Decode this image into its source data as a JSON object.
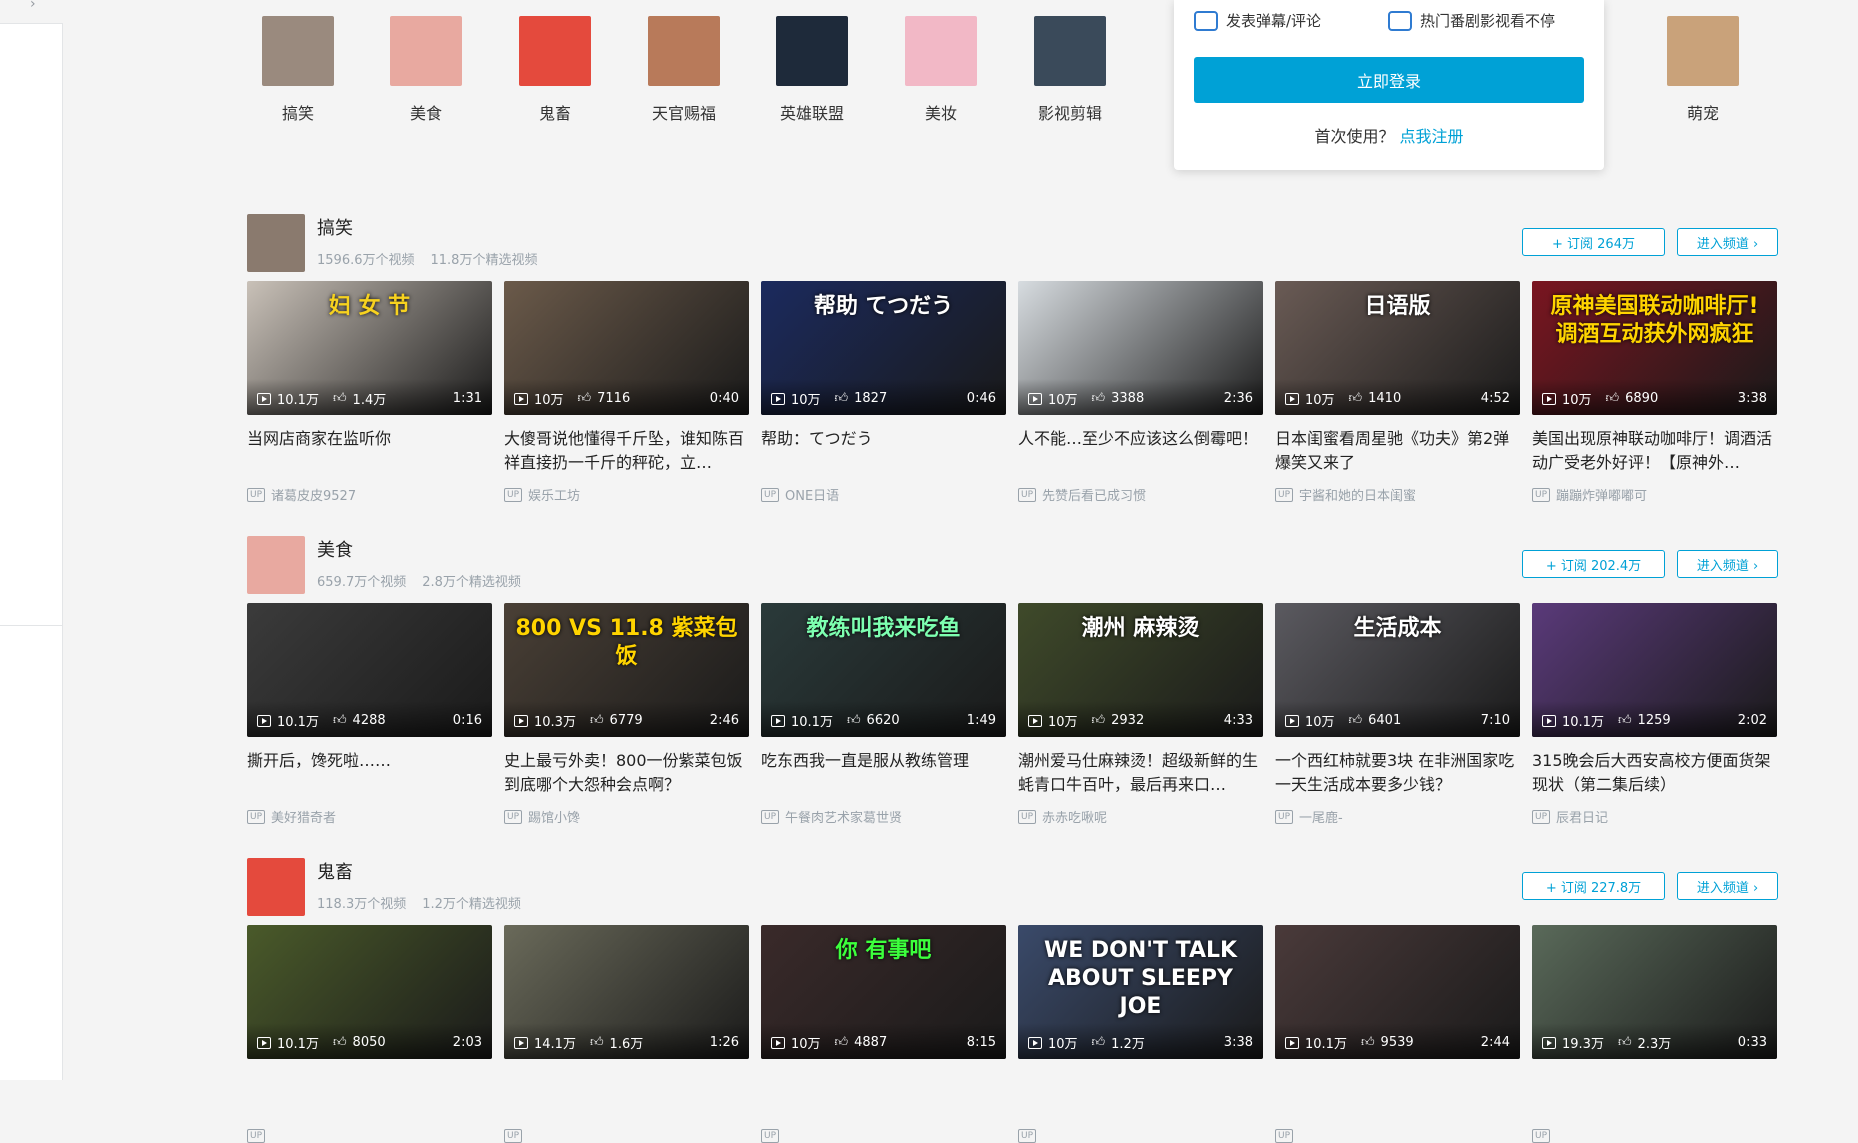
{
  "categories": [
    {
      "label": "搞笑",
      "icon": "funny-avatar",
      "color": "#9a8a7e"
    },
    {
      "label": "美食",
      "icon": "cake-avatar",
      "color": "#e8a9a0"
    },
    {
      "label": "鬼畜",
      "icon": "red-hair-girl-avatar",
      "color": "#e44a3d"
    },
    {
      "label": "天官赐福",
      "icon": "anime-art-avatar",
      "color": "#b87a5a"
    },
    {
      "label": "英雄联盟",
      "icon": "lol-logo",
      "color": "#1e2a3a"
    },
    {
      "label": "美妆",
      "icon": "lips-avatar",
      "color": "#f2b8c6"
    },
    {
      "label": "影视剪辑",
      "icon": "editing-software-avatar",
      "color": "#3a4a5a"
    },
    {
      "label": "萌宠",
      "icon": "dog-avatar",
      "color": "#c9a27a"
    }
  ],
  "login_popup": {
    "feature1": "发表弹幕/评论",
    "feature2": "热门番剧影视看不停",
    "login_button": "立即登录",
    "register_prompt": "首次使用？",
    "register_link": "点我注册"
  },
  "sections": [
    {
      "title": "搞笑",
      "video_count": "1596.6万个视频",
      "featured_count": "11.8万个精选视频",
      "subscribe": "+ 订阅 264万",
      "enter": "进入频道 ›",
      "avatar_color": "#8a7a6e",
      "videos": [
        {
          "views": "10.1万",
          "likes": "1.4万",
          "duration": "1:31",
          "title": "当网店商家在监听你",
          "up": "诸葛皮皮9527",
          "bg": "#c9c1b8",
          "overlay": "妇 女 节",
          "ocolor": "#f7d21f"
        },
        {
          "views": "10万",
          "likes": "7116",
          "duration": "0:40",
          "title": "大傻哥说他懂得千斤坠，谁知陈百祥直接扔一千斤的秤砣，立…",
          "up": "娱乐工坊",
          "bg": "#6b5a4a",
          "overlay": "",
          "ocolor": "#fff"
        },
        {
          "views": "10万",
          "likes": "1827",
          "duration": "0:46",
          "title": "帮助：てつだう",
          "up": "ONE日语",
          "bg": "#1b2a5e",
          "overlay": "帮助 てつだう",
          "ocolor": "#ffffff"
        },
        {
          "views": "10万",
          "likes": "3388",
          "duration": "2:36",
          "title": "人不能…至少不应该这么倒霉吧！",
          "up": "先赞后看已成习惯",
          "bg": "#d7dce0",
          "overlay": "",
          "ocolor": "#fff"
        },
        {
          "views": "10万",
          "likes": "1410",
          "duration": "4:52",
          "title": "日本闺蜜看周星驰《功夫》第2弹 爆笑又来了",
          "up": "宇酱和她的日本闺蜜",
          "bg": "#6a5b55",
          "overlay": "日语版",
          "ocolor": "#ffffff"
        },
        {
          "views": "10万",
          "likes": "6890",
          "duration": "3:38",
          "title": "美国出现原神联动咖啡厅！调酒活动广受老外好评！【原神外…",
          "up": "蹦蹦炸弹嘟嘟可",
          "bg": "#7a1520",
          "overlay": "原神美国联动咖啡厅! 调酒互动获外网疯狂",
          "ocolor": "#ffd400"
        }
      ]
    },
    {
      "title": "美食",
      "video_count": "659.7万个视频",
      "featured_count": "2.8万个精选视频",
      "subscribe": "+ 订阅 202.4万",
      "enter": "进入频道 ›",
      "avatar_color": "#e8a9a0",
      "videos": [
        {
          "views": "10.1万",
          "likes": "4288",
          "duration": "0:16",
          "title": "撕开后，馋死啦……",
          "up": "美好猎奇者",
          "bg": "#3b3b3b",
          "overlay": "",
          "ocolor": "#fff"
        },
        {
          "views": "10.3万",
          "likes": "6779",
          "duration": "2:46",
          "title": "史上最亏外卖！800一份紫菜包饭到底哪个大怨种会点啊？",
          "up": "踢馆小馋",
          "bg": "#4a4036",
          "overlay": "800 VS 11.8 紫菜包饭",
          "ocolor": "#ffd400"
        },
        {
          "views": "10.1万",
          "likes": "6620",
          "duration": "1:49",
          "title": "吃东西我一直是服从教练管理",
          "up": "午餐肉艺术家葛世贤",
          "bg": "#2a3a3a",
          "overlay": "教练叫我来吃鱼",
          "ocolor": "#7dffb0"
        },
        {
          "views": "10万",
          "likes": "2932",
          "duration": "4:33",
          "title": "潮州爱马仕麻辣烫！超级新鲜的生蚝青口牛百叶，最后再来口…",
          "up": "赤赤吃啾呢",
          "bg": "#3f4a2a",
          "overlay": "潮州 麻辣烫",
          "ocolor": "#ffffff"
        },
        {
          "views": "10万",
          "likes": "6401",
          "duration": "7:10",
          "title": "一个西红柿就要3块 在非洲国家吃一天生活成本要多少钱？",
          "up": "一尾鹿-",
          "bg": "#5b5a60",
          "overlay": "生活成本",
          "ocolor": "#ffffff"
        },
        {
          "views": "10.1万",
          "likes": "1259",
          "duration": "2:02",
          "title": "315晚会后大西安高校方便面货架现状（第二集后续）",
          "up": "辰君日记",
          "bg": "#5a3a7a",
          "overlay": "",
          "ocolor": "#fff"
        }
      ]
    },
    {
      "title": "鬼畜",
      "video_count": "118.3万个视频",
      "featured_count": "1.2万个精选视频",
      "subscribe": "+ 订阅 227.8万",
      "enter": "进入频道 ›",
      "avatar_color": "#e44a3d",
      "videos": [
        {
          "views": "10.1万",
          "likes": "8050",
          "duration": "2:03",
          "title": "",
          "up": "",
          "bg": "#4a5a2a",
          "overlay": "",
          "ocolor": "#fff"
        },
        {
          "views": "14.1万",
          "likes": "1.6万",
          "duration": "1:26",
          "title": "",
          "up": "",
          "bg": "#6a6a5a",
          "overlay": "",
          "ocolor": "#fff"
        },
        {
          "views": "10万",
          "likes": "4887",
          "duration": "8:15",
          "title": "",
          "up": "",
          "bg": "#3a2a2a",
          "overlay": "你 有事吧",
          "ocolor": "#3cff3c"
        },
        {
          "views": "10万",
          "likes": "1.2万",
          "duration": "3:38",
          "title": "",
          "up": "",
          "bg": "#3a4a6a",
          "overlay": "WE DON'T TALK ABOUT SLEEPY JOE",
          "ocolor": "#ffffff"
        },
        {
          "views": "10.1万",
          "likes": "9539",
          "duration": "2:44",
          "title": "",
          "up": "",
          "bg": "#4a3a3a",
          "overlay": "",
          "ocolor": "#fff"
        },
        {
          "views": "19.3万",
          "likes": "2.3万",
          "duration": "0:33",
          "title": "",
          "up": "",
          "bg": "#5a6a5a",
          "overlay": "",
          "ocolor": "#fff"
        }
      ]
    }
  ]
}
